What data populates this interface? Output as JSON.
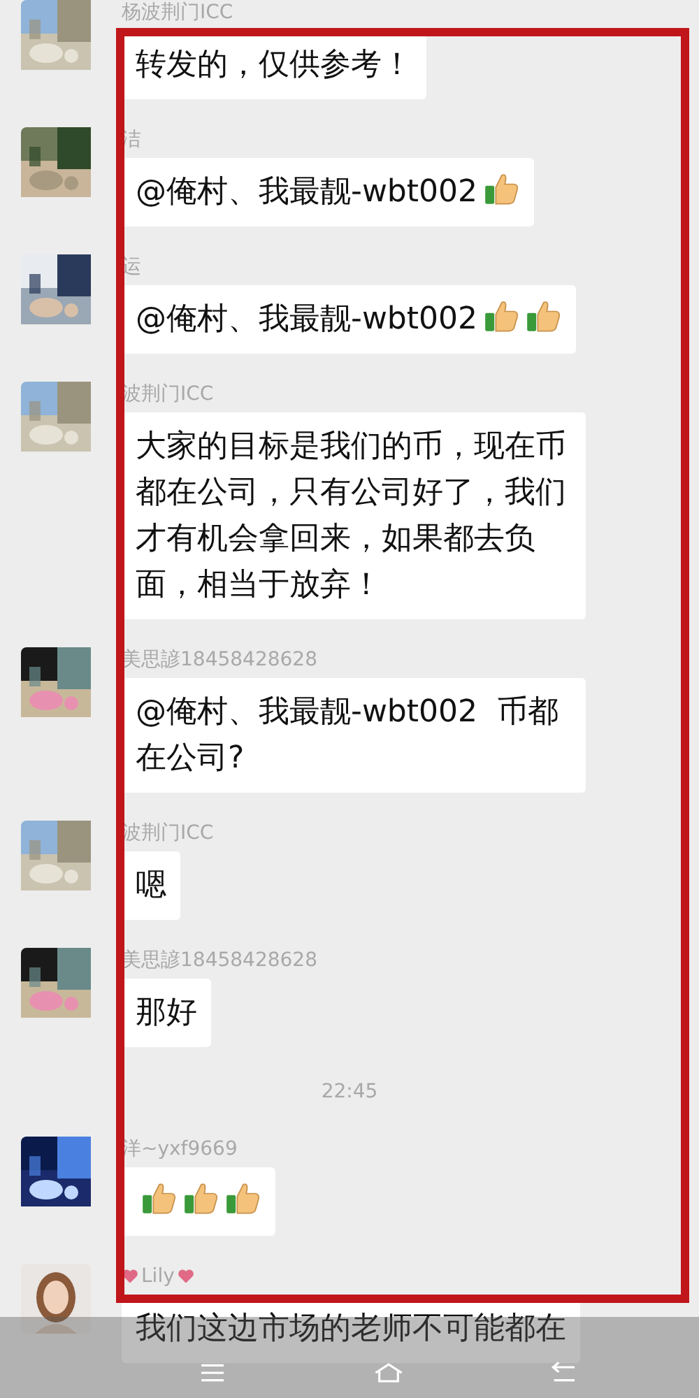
{
  "messages": [
    {
      "kind": "message",
      "sender": "杨波荆门ICC",
      "decorated": false,
      "parts": [
        {
          "kind": "text",
          "text": "转发的，仅供参考！"
        }
      ]
    },
    {
      "kind": "message",
      "sender": "洁",
      "decorated": false,
      "parts": [
        {
          "kind": "text",
          "text": "@俺村、我最靓-wbt002"
        },
        {
          "kind": "thumbs-up"
        }
      ]
    },
    {
      "kind": "message",
      "sender": "运",
      "decorated": false,
      "parts": [
        {
          "kind": "text",
          "text": "@俺村、我最靓-wbt002"
        },
        {
          "kind": "thumbs-up"
        },
        {
          "kind": "thumbs-up"
        }
      ]
    },
    {
      "kind": "message",
      "sender": "波荆门ICC",
      "decorated": false,
      "parts": [
        {
          "kind": "text",
          "text": "大家的目标是我们的币，现在币都在公司，只有公司好了，我们才有机会拿回来，如果都去负面，相当于放弃！"
        }
      ]
    },
    {
      "kind": "message",
      "sender": "美思諺18458428628",
      "decorated": false,
      "parts": [
        {
          "kind": "text",
          "text": "@俺村、我最靓-wbt002  币都在公司?"
        }
      ]
    },
    {
      "kind": "message",
      "sender": "波荆门ICC",
      "decorated": false,
      "parts": [
        {
          "kind": "text",
          "text": "嗯"
        }
      ]
    },
    {
      "kind": "message",
      "sender": "美思諺18458428628",
      "decorated": false,
      "parts": [
        {
          "kind": "text",
          "text": "那好"
        }
      ]
    },
    {
      "kind": "time",
      "text": "22:45"
    },
    {
      "kind": "message",
      "sender": "洋~yxf9669",
      "decorated": false,
      "parts": [
        {
          "kind": "thumbs-up"
        },
        {
          "kind": "thumbs-up"
        },
        {
          "kind": "thumbs-up"
        }
      ]
    },
    {
      "kind": "message",
      "sender": "Lily",
      "decorated": true,
      "parts": [
        {
          "kind": "text",
          "text": "我们这边市场的老师不可能都在"
        }
      ]
    }
  ]
}
